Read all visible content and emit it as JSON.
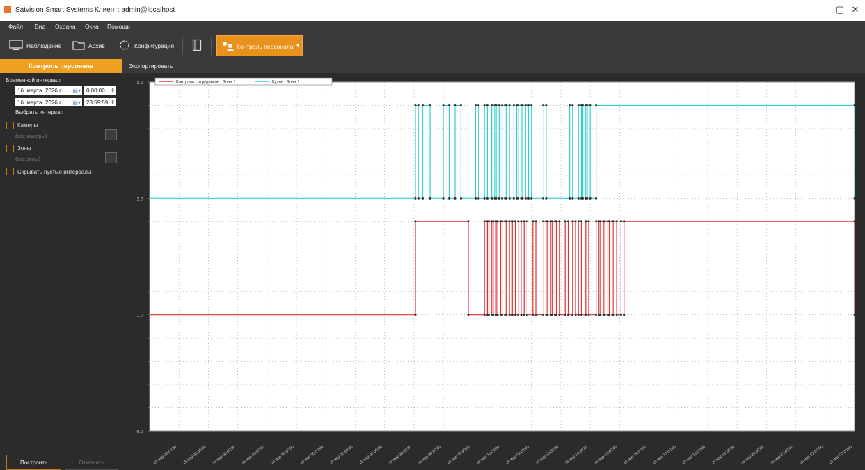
{
  "window": {
    "title": "Satvision Smart Systems Клиент: admin@localhost"
  },
  "menu": [
    "Файл",
    "Вид",
    "Охрана",
    "Окна",
    "Помощь"
  ],
  "toolbar": {
    "observation": "Наблюдение",
    "archive": "Архив",
    "configuration": "Конфигурация",
    "personnel": "Контроль персонала"
  },
  "sidebar": {
    "header": "Контроль персонала",
    "interval_label": "Временной интервал",
    "from": {
      "day": "16",
      "month": "марта",
      "year": "2026 г.",
      "time": "0:00:00"
    },
    "to": {
      "day": "16",
      "month": "марта",
      "year": "2026 г.",
      "time": "23:59:59"
    },
    "choose_interval": "Выбрать интервал",
    "cameras_label": "Камеры",
    "cameras_placeholder": "(все камеры)",
    "zones_label": "Зоны",
    "zones_placeholder": "(все зоны)",
    "hide_empty": "Скрывать пустые интервалы",
    "build_button": "Построить",
    "cancel_button": "Отменить"
  },
  "content": {
    "export_tab": "Экспортировать"
  },
  "colors": {
    "accent": "#f0a020",
    "series_red": "#e03030",
    "series_cyan": "#30d0d0"
  },
  "chart_data": {
    "type": "line",
    "title": "",
    "ylim": [
      0,
      3
    ],
    "yticks": [
      "0.0",
      "1.0",
      "2.0",
      "3.0"
    ],
    "xticks": [
      "16 мар 00:00:00",
      "16 мар 01:00:00",
      "16 мар 02:00:00",
      "16 мар 03:00:00",
      "16 мар 04:00:00",
      "16 мар 05:00:00",
      "16 мар 06:00:00",
      "16 мар 07:00:00",
      "16 мар 08:00:00",
      "16 мар 09:00:00",
      "16 мар 10:00:00",
      "16 мар 11:00:00",
      "16 мар 12:00:00",
      "16 мар 13:00:00",
      "16 мар 14:00:00",
      "16 мар 15:00:00",
      "16 мар 16:00:00",
      "16 мар 17:00:00",
      "16 мар 18:00:00",
      "16 мар 19:00:00",
      "16 мар 20:00:00",
      "16 мар 21:00:00",
      "16 мар 22:00:00",
      "16 мар 23:00:00"
    ],
    "grid": true,
    "legend": "top-left",
    "series": [
      {
        "name": "Контроль сотрудников | Зона 1",
        "low": 1.0,
        "high": 1.8,
        "color": "#e03030",
        "high_intervals": [
          [
            9.05,
            10.85
          ],
          [
            11.4,
            11.5
          ],
          [
            11.55,
            11.65
          ],
          [
            11.7,
            11.8
          ],
          [
            11.85,
            11.95
          ],
          [
            12.0,
            12.1
          ],
          [
            12.15,
            12.25
          ],
          [
            12.35,
            12.45
          ],
          [
            12.55,
            12.65
          ],
          [
            12.75,
            12.85
          ],
          [
            13.05,
            13.15
          ],
          [
            13.4,
            13.5
          ],
          [
            13.55,
            13.65
          ],
          [
            13.7,
            13.8
          ],
          [
            13.85,
            13.95
          ],
          [
            14.15,
            14.25
          ],
          [
            14.4,
            14.5
          ],
          [
            14.6,
            14.7
          ],
          [
            14.85,
            14.95
          ],
          [
            15.2,
            15.3
          ],
          [
            15.35,
            15.45
          ],
          [
            15.5,
            15.6
          ],
          [
            15.65,
            15.75
          ],
          [
            15.8,
            15.9
          ],
          [
            16.05,
            16.15
          ],
          [
            24.0,
            24.0
          ]
        ],
        "tail_high_from": 16.15
      },
      {
        "name": "Кухня | Зона 1",
        "low": 2.0,
        "high": 2.8,
        "color": "#30d0d0",
        "high_intervals": [
          [
            9.05,
            9.15
          ],
          [
            9.3,
            9.55
          ],
          [
            10.0,
            10.2
          ],
          [
            10.4,
            10.6
          ],
          [
            11.1,
            11.2
          ],
          [
            11.4,
            11.5
          ],
          [
            11.65,
            11.75
          ],
          [
            11.8,
            11.9
          ],
          [
            12.0,
            12.1
          ],
          [
            12.15,
            12.25
          ],
          [
            12.4,
            12.5
          ],
          [
            12.55,
            12.65
          ],
          [
            12.7,
            12.8
          ],
          [
            12.9,
            13.0
          ],
          [
            13.4,
            13.5
          ],
          [
            14.3,
            14.4
          ],
          [
            14.6,
            14.7
          ],
          [
            14.75,
            14.85
          ],
          [
            14.9,
            15.0
          ]
        ],
        "tail_high_from": 15.2
      }
    ]
  }
}
